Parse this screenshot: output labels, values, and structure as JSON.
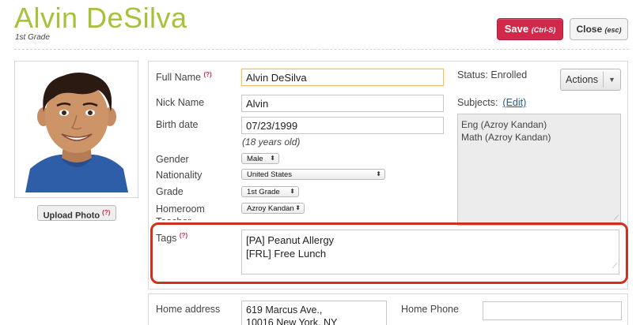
{
  "student": {
    "name": "Alvin DeSilva",
    "grade": "1st Grade"
  },
  "header": {
    "save_label": "Save",
    "save_hint": "(Ctrl-S)",
    "close_label": "Close",
    "close_hint": "(esc)"
  },
  "photo": {
    "upload_label": "Upload Photo",
    "upload_help": "(?)"
  },
  "form": {
    "full_name_label": "Full Name",
    "full_name_help": "(?)",
    "full_name_value": "Alvin DeSilva",
    "nick_name_label": "Nick Name",
    "nick_name_value": "Alvin",
    "birth_date_label": "Birth date",
    "birth_date_value": "07/23/1999",
    "age_note": "(18 years old)",
    "gender_label": "Gender",
    "gender_value": "Male",
    "nationality_label": "Nationality",
    "nationality_value": "United States",
    "grade_label": "Grade",
    "grade_value": "1st Grade",
    "homeroom_label": "Homeroom Teacher",
    "homeroom_value": "Azroy Kandan",
    "tags_label": "Tags",
    "tags_help": "(?)",
    "tags": [
      "[PA] Peanut Allergy",
      "[FRL] Free Lunch"
    ]
  },
  "status": {
    "status_text": "Status: Enrolled",
    "actions_label": "Actions",
    "subjects_label": "Subjects:",
    "subjects_edit": "(Edit)",
    "subjects": [
      "Eng  (Azroy Kandan)",
      "Math  (Azroy Kandan)"
    ]
  },
  "contact": {
    "home_address_label": "Home address",
    "home_address_lines": [
      "619 Marcus Ave.,",
      "10016 New York, NY"
    ],
    "home_phone_label": "Home Phone"
  },
  "colors": {
    "accent_green": "#a6c13a",
    "save_red": "#d1284b",
    "highlight_red": "#d0311f",
    "link_blue": "#1a5d8f"
  }
}
